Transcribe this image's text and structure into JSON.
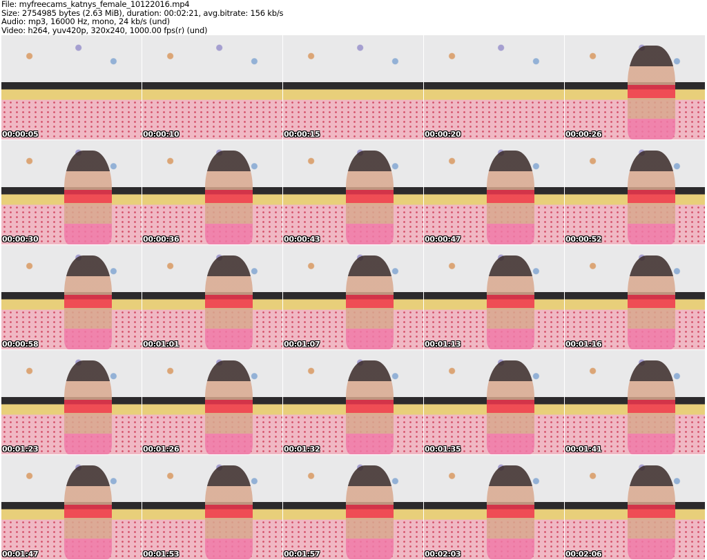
{
  "header": {
    "file": "File: myfreecams_katnys_female_10122016.mp4",
    "size": "Size: 2754985 bytes (2.63 MiB), duration: 00:02:21, avg.bitrate: 156 kb/s",
    "audio": "Audio: mp3, 16000 Hz, mono, 24 kb/s (und)",
    "video": "Video: h264, yuv420p, 320x240, 1000.00 fps(r) (und)"
  },
  "frames": [
    {
      "time": "00:00:05",
      "person": false
    },
    {
      "time": "00:00:10",
      "person": false
    },
    {
      "time": "00:00:15",
      "person": false
    },
    {
      "time": "00:00:20",
      "person": false
    },
    {
      "time": "00:00:26",
      "person": true
    },
    {
      "time": "00:00:30",
      "person": true
    },
    {
      "time": "00:00:36",
      "person": true
    },
    {
      "time": "00:00:43",
      "person": true
    },
    {
      "time": "00:00:47",
      "person": true
    },
    {
      "time": "00:00:52",
      "person": true
    },
    {
      "time": "00:00:58",
      "person": true
    },
    {
      "time": "00:01:01",
      "person": true
    },
    {
      "time": "00:01:07",
      "person": true
    },
    {
      "time": "00:01:13",
      "person": true
    },
    {
      "time": "00:01:16",
      "person": true
    },
    {
      "time": "00:01:23",
      "person": true
    },
    {
      "time": "00:01:26",
      "person": true
    },
    {
      "time": "00:01:32",
      "person": true
    },
    {
      "time": "00:01:35",
      "person": true
    },
    {
      "time": "00:01:41",
      "person": true
    },
    {
      "time": "00:01:47",
      "person": true
    },
    {
      "time": "00:01:53",
      "person": true
    },
    {
      "time": "00:01:57",
      "person": true
    },
    {
      "time": "00:02:03",
      "person": true
    },
    {
      "time": "00:02:06",
      "person": true
    }
  ]
}
